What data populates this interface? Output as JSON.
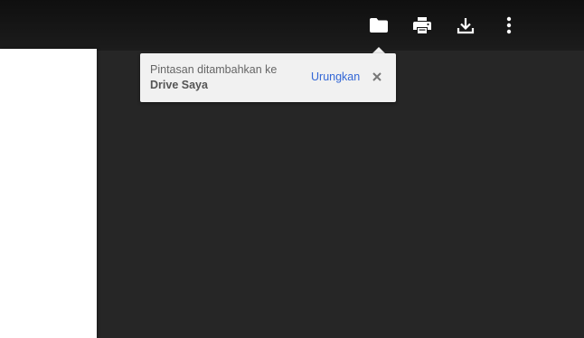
{
  "toolbar": {
    "buttons": [
      {
        "icon": "folder-icon",
        "action": "add-to-drive"
      },
      {
        "icon": "print-icon",
        "action": "print"
      },
      {
        "icon": "download-icon",
        "action": "download"
      },
      {
        "icon": "more-vert-icon",
        "action": "more-options"
      }
    ],
    "icon_color": "#ffffff"
  },
  "toast": {
    "message_line1": "Pintasan ditambahkan ke",
    "message_line2": "Drive Saya",
    "undo_label": "Urungkan",
    "close_icon": "close-icon",
    "link_color": "#3367d6",
    "background": "#f1f1f1"
  },
  "viewer": {
    "background": "#262626",
    "page_color": "#ffffff"
  }
}
